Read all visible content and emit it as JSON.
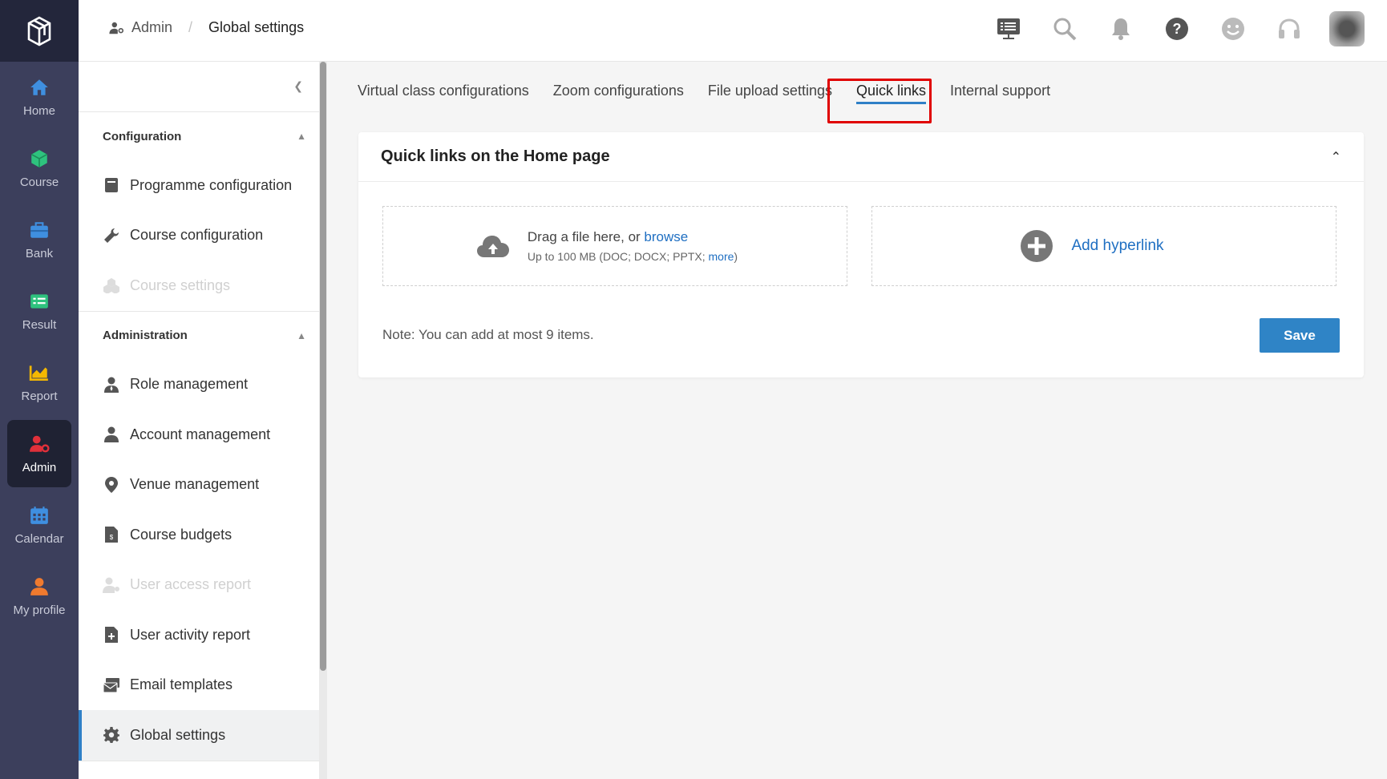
{
  "rail": {
    "items": [
      {
        "label": "Home",
        "icon": "home-icon"
      },
      {
        "label": "Course",
        "icon": "cube-icon"
      },
      {
        "label": "Bank",
        "icon": "briefcase-icon"
      },
      {
        "label": "Result",
        "icon": "list-icon"
      },
      {
        "label": "Report",
        "icon": "chart-icon"
      },
      {
        "label": "Admin",
        "icon": "user-gear-icon"
      },
      {
        "label": "Calendar",
        "icon": "calendar-icon"
      },
      {
        "label": "My profile",
        "icon": "user-icon"
      }
    ]
  },
  "breadcrumb": {
    "first": "Admin",
    "separator": "/",
    "current": "Global settings"
  },
  "subnav": {
    "sections": [
      {
        "title": "Configuration",
        "items": [
          {
            "label": "Programme configuration",
            "icon": "book-icon"
          },
          {
            "label": "Course configuration",
            "icon": "wrench-icon"
          },
          {
            "label": "Course settings",
            "icon": "cubes-icon"
          }
        ]
      },
      {
        "title": "Administration",
        "items": [
          {
            "label": "Role management",
            "icon": "user-tie-icon"
          },
          {
            "label": "Account management",
            "icon": "user-icon"
          },
          {
            "label": "Venue management",
            "icon": "map-pin-icon"
          },
          {
            "label": "Course budgets",
            "icon": "invoice-icon"
          },
          {
            "label": "User access report",
            "icon": "user-key-icon"
          },
          {
            "label": "User activity report",
            "icon": "file-plus-icon"
          },
          {
            "label": "Email templates",
            "icon": "mail-stack-icon"
          },
          {
            "label": "Global settings",
            "icon": "gear-icon"
          }
        ]
      }
    ]
  },
  "tabs": [
    {
      "label": "Virtual class configurations"
    },
    {
      "label": "Zoom configurations"
    },
    {
      "label": "File upload settings"
    },
    {
      "label": "Quick links"
    },
    {
      "label": "Internal support"
    }
  ],
  "card": {
    "title": "Quick links on the Home page",
    "upload": {
      "main_prefix": "Drag a file here, or ",
      "browse": "browse",
      "sub_prefix": "Up to 100 MB (DOC; DOCX; PPTX; ",
      "more": "more",
      "sub_suffix": ")"
    },
    "add_hyperlink": "Add hyperlink",
    "note": "Note: You can add at most 9 items.",
    "save": "Save"
  },
  "colors": {
    "accent": "#2f80c7",
    "rail_bg": "#3c3f5c",
    "highlight": "#e00000",
    "admin_icon": "#e0303a"
  }
}
